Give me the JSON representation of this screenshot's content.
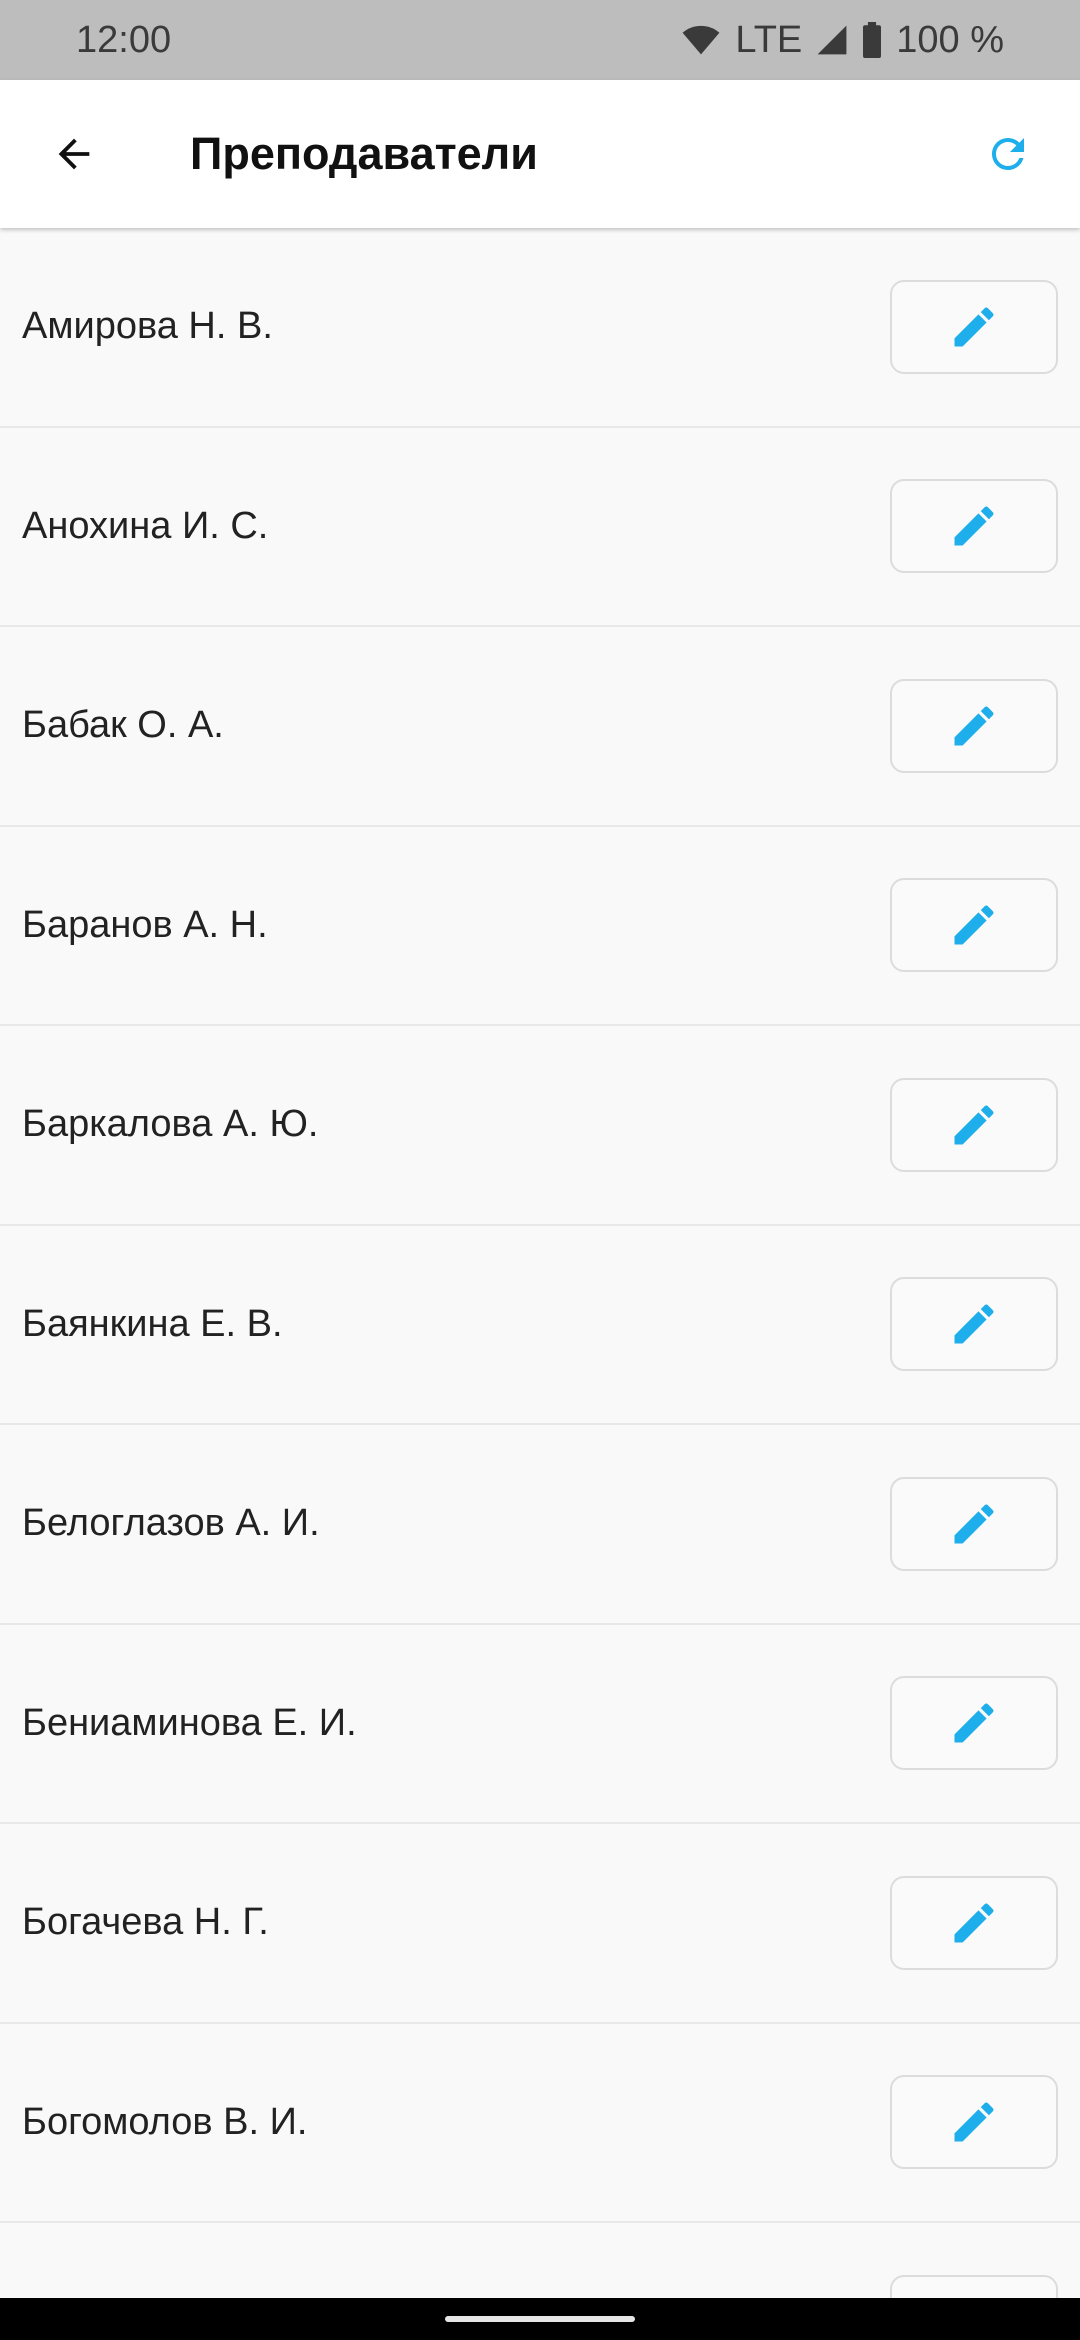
{
  "status_bar": {
    "time": "12:00",
    "network": "LTE",
    "battery": "100 %"
  },
  "app_bar": {
    "title": "Преподаватели",
    "back_icon": "arrow-left-icon",
    "refresh_icon": "refresh-icon"
  },
  "teachers": [
    {
      "name": "Амирова Н. В."
    },
    {
      "name": "Анохина И. С."
    },
    {
      "name": "Бабак О. А."
    },
    {
      "name": "Баранов А. Н."
    },
    {
      "name": "Баркалова А. Ю."
    },
    {
      "name": "Баянкина Е. В."
    },
    {
      "name": "Белоглазов А. И."
    },
    {
      "name": "Бениаминова Е. И."
    },
    {
      "name": "Богачева Н. Г."
    },
    {
      "name": "Богомолов В. И."
    }
  ],
  "colors": {
    "accent": "#1EAEEB",
    "status_bar_bg": "#BDBDBD",
    "list_bg": "#F9F9F9"
  }
}
